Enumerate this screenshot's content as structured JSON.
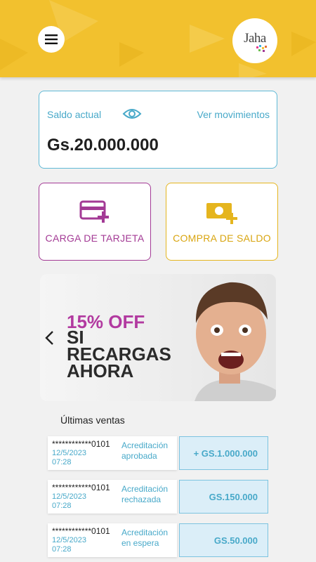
{
  "header": {
    "menu_icon": "hamburger-menu-icon",
    "logo_text": "Jaha",
    "brand_color": "#f2c12e"
  },
  "balance": {
    "label": "Saldo actual",
    "toggle_icon": "eye-icon",
    "movements_link": "Ver movimientos",
    "amount": "Gs.20.000.000"
  },
  "actions": [
    {
      "label": "CARGA DE TARJETA",
      "icon": "card-add-icon",
      "color": "#a33a95"
    },
    {
      "label": "COMPRA DE SALDO",
      "icon": "cash-add-icon",
      "color": "#e5b51e"
    }
  ],
  "banner": {
    "headline": "15% OFF",
    "subline": "SI RECARGAS AHORA",
    "prev_icon": "chevron-left-icon"
  },
  "sales": {
    "title": "Últimas ventas",
    "items": [
      {
        "id": "************0101",
        "date": "12/5/2023",
        "time": "07:28",
        "status": "Acreditación aprobada",
        "amount": "+ GS.1.000.000"
      },
      {
        "id": "************0101",
        "date": "12/5/2023",
        "time": "07:28",
        "status": "Acreditación rechazada",
        "amount": "GS.150.000"
      },
      {
        "id": "************0101",
        "date": "12/5/2023",
        "time": "07:28",
        "status": "Acreditación en espera",
        "amount": "GS.50.000"
      }
    ]
  }
}
